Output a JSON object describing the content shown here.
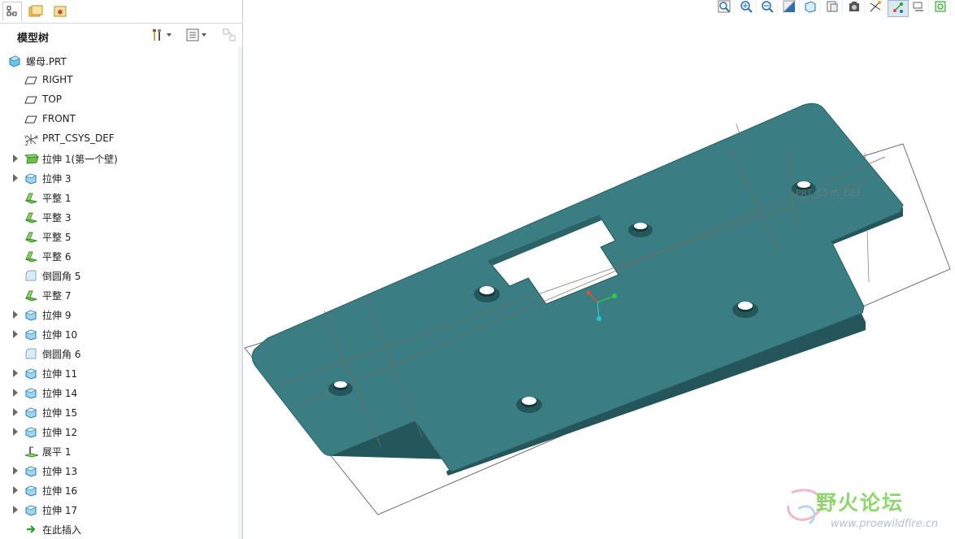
{
  "panel": {
    "title": "模型树",
    "tabs": [
      "model-tree",
      "folder-browser",
      "favorites"
    ]
  },
  "tree": [
    {
      "label": "螺母.PRT",
      "icon": "part-icon",
      "indent": 0,
      "expandable": false
    },
    {
      "label": "RIGHT",
      "icon": "datum-plane-icon",
      "indent": 1,
      "expandable": false
    },
    {
      "label": "TOP",
      "icon": "datum-plane-icon",
      "indent": 1,
      "expandable": false
    },
    {
      "label": "FRONT",
      "icon": "datum-plane-icon",
      "indent": 1,
      "expandable": false
    },
    {
      "label": "PRT_CSYS_DEF",
      "icon": "csys-icon",
      "indent": 1,
      "expandable": false
    },
    {
      "label": "拉伸 1(第一个壁)",
      "icon": "first-wall-icon",
      "indent": 1,
      "expandable": true
    },
    {
      "label": "拉伸 3",
      "icon": "extrude-icon",
      "indent": 1,
      "expandable": true
    },
    {
      "label": "平整 1",
      "icon": "flat-wall-icon",
      "indent": 1,
      "expandable": false
    },
    {
      "label": "平整 3",
      "icon": "flat-wall-icon",
      "indent": 1,
      "expandable": false
    },
    {
      "label": "平整 5",
      "icon": "flat-wall-icon",
      "indent": 1,
      "expandable": false
    },
    {
      "label": "平整 6",
      "icon": "flat-wall-icon",
      "indent": 1,
      "expandable": false
    },
    {
      "label": "倒圆角 5",
      "icon": "round-icon",
      "indent": 1,
      "expandable": false
    },
    {
      "label": "平整 7",
      "icon": "flat-wall-icon",
      "indent": 1,
      "expandable": false
    },
    {
      "label": "拉伸 9",
      "icon": "extrude-icon",
      "indent": 1,
      "expandable": true
    },
    {
      "label": "拉伸 10",
      "icon": "extrude-icon",
      "indent": 1,
      "expandable": true
    },
    {
      "label": "倒圆角 6",
      "icon": "round-icon",
      "indent": 1,
      "expandable": false
    },
    {
      "label": "拉伸 11",
      "icon": "extrude-icon",
      "indent": 1,
      "expandable": true
    },
    {
      "label": "拉伸 14",
      "icon": "extrude-icon",
      "indent": 1,
      "expandable": true
    },
    {
      "label": "拉伸 15",
      "icon": "extrude-icon",
      "indent": 1,
      "expandable": true
    },
    {
      "label": "拉伸 12",
      "icon": "extrude-icon",
      "indent": 1,
      "expandable": true
    },
    {
      "label": "展平 1",
      "icon": "unbend-icon",
      "indent": 1,
      "expandable": false
    },
    {
      "label": "拉伸 13",
      "icon": "extrude-icon",
      "indent": 1,
      "expandable": true
    },
    {
      "label": "拉伸 16",
      "icon": "extrude-icon",
      "indent": 1,
      "expandable": true
    },
    {
      "label": "拉伸 17",
      "icon": "extrude-icon",
      "indent": 1,
      "expandable": true
    },
    {
      "label": "在此插入",
      "icon": "insert-here-icon",
      "indent": 1,
      "expandable": false
    }
  ],
  "toolbar": [
    "refit-icon",
    "zoom-in-icon",
    "zoom-out-icon",
    "repaint-icon",
    "display-style-icon",
    "saved-views-icon",
    "view-manager-icon",
    "datum-display-icon",
    "csys-display-icon",
    "annotation-display-icon",
    "spin-center-icon"
  ],
  "viewport": {
    "csys_label": "PRT_CSYS_DEF",
    "part_color": "#3a7d82",
    "edge_color": "#24575c",
    "background": "#ffffff"
  },
  "watermark": {
    "title": "野火论坛",
    "url": "www.proewildfire.cn"
  }
}
